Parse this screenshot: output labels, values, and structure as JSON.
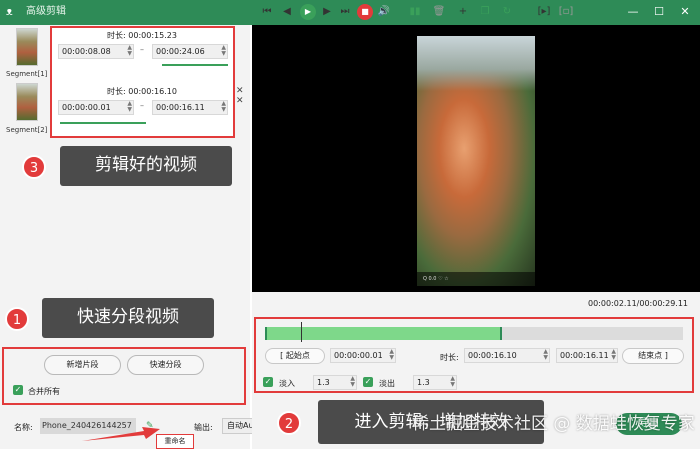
{
  "window": {
    "title": "高级剪辑"
  },
  "segments": [
    {
      "label": "Segment[1]",
      "duration_label": "时长:",
      "duration": "00:00:15.23",
      "start": "00:00:08.08",
      "end": "00:00:24.06"
    },
    {
      "label": "Segment[2]",
      "duration_label": "时长:",
      "duration": "00:00:16.10",
      "start": "00:00:00.01",
      "end": "00:00:16.11"
    }
  ],
  "callouts": [
    {
      "num": "3",
      "text": "剪辑好的视频"
    },
    {
      "num": "1",
      "text": "快速分段视频"
    },
    {
      "num": "2",
      "text": "进入剪辑，增加特效"
    }
  ],
  "left_buttons": {
    "new_segment": "新增片段",
    "quick_split": "快速分段",
    "merge_all": "合并所有"
  },
  "bottom": {
    "name_label": "名称:",
    "name_value": "Phone_240426144257",
    "rename": "重命名",
    "output_label": "输出:",
    "output_value": "自动Auto",
    "export": "导出"
  },
  "player": {
    "time_display": "00:00:02.11/00:00:29.11",
    "frame_bar": "Q 0.0 ♡ ☆"
  },
  "edit": {
    "start_point_label": "起始点",
    "start_value": "00:00:00.01",
    "duration_label": "时长:",
    "duration_value": "00:00:16.10",
    "end_value": "00:00:16.11",
    "end_point_label": "结束点",
    "fade_in_label": "淡入",
    "fade_in_value": "1.3",
    "fade_out_label": "淡出",
    "fade_out_value": "1.3"
  },
  "watermark": "稀土掘金技术社区 @ 数据蛙恢复专家",
  "colors": {
    "accent": "#2e8b57",
    "highlight": "#e23b3b",
    "track_fill": "#7ed88a"
  }
}
